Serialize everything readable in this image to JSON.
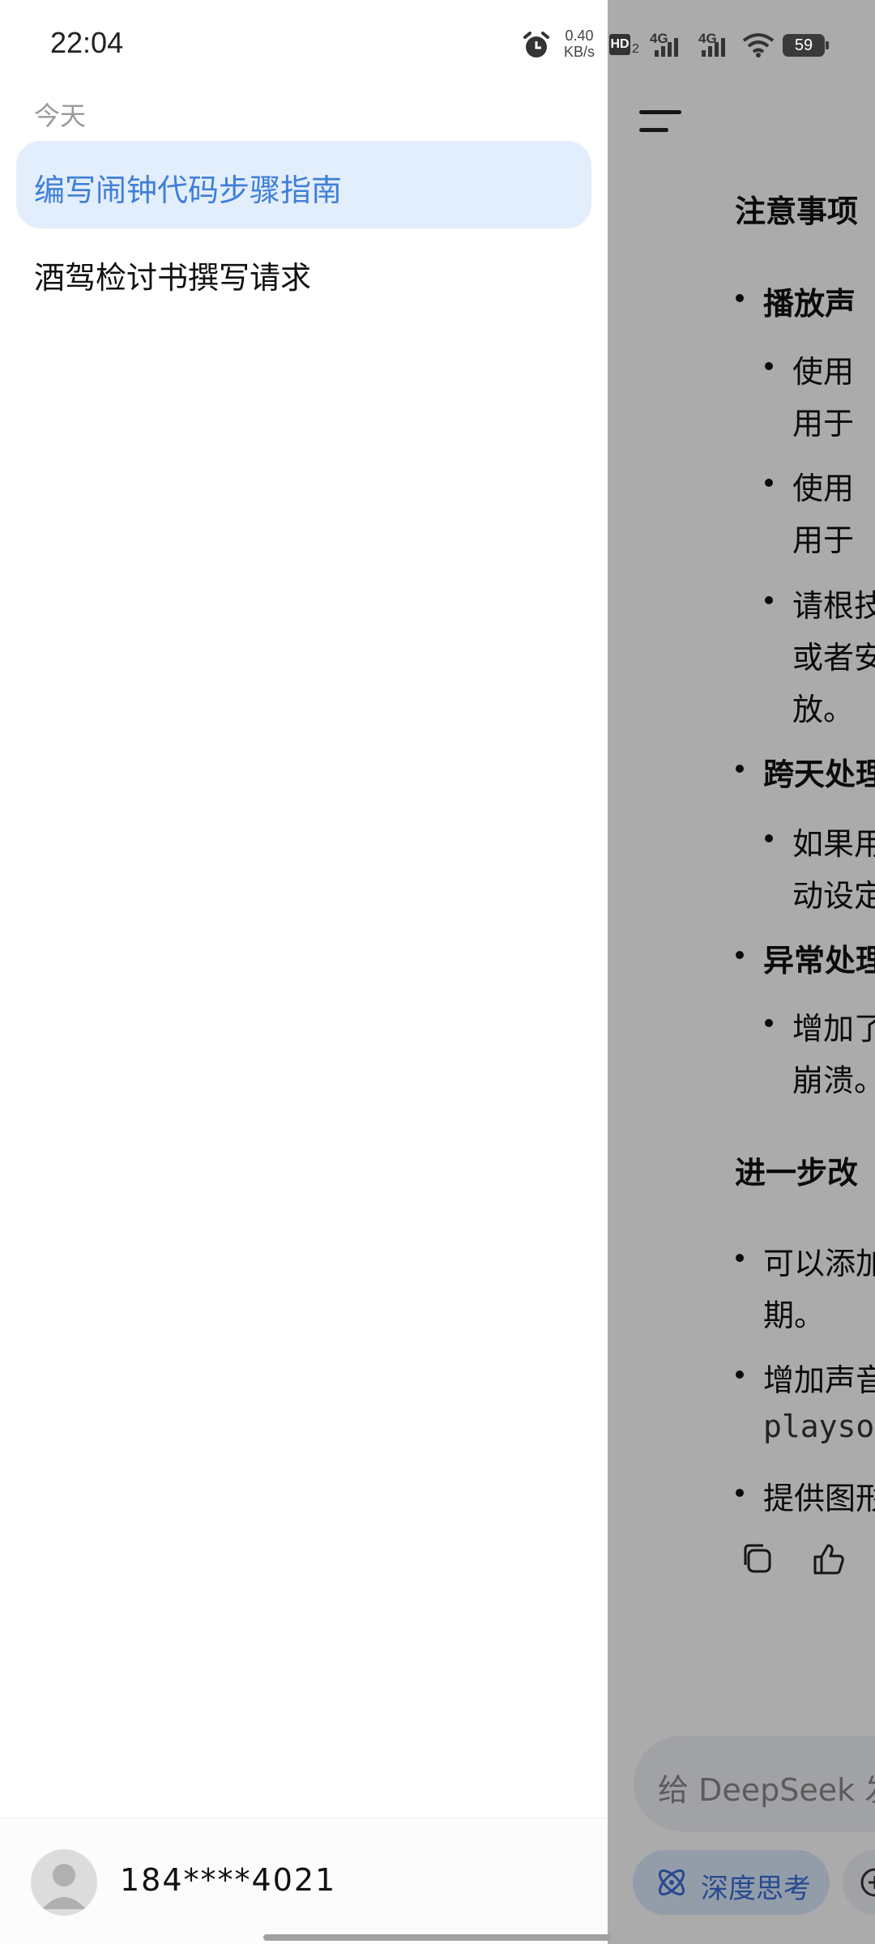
{
  "status_bar": {
    "time": "22:04",
    "net_speed_value": "0.40",
    "net_speed_unit": "KB/s",
    "hd_label": "HD",
    "hd_sub": "2",
    "sig1_label": "4G",
    "sig2_label": "4G",
    "battery": "59"
  },
  "drawer": {
    "section_label": "今天",
    "conversations": [
      {
        "title": "编写闹钟代码步骤指南",
        "active": true
      },
      {
        "title": "酒驾检讨书撰写请求",
        "active": false
      }
    ],
    "user": {
      "phone": "184****4021"
    }
  },
  "chat": {
    "heading_notes": "注意事项",
    "items": [
      {
        "text": "播放声",
        "bold": true,
        "level": 1
      },
      {
        "text": "使用",
        "bold": false,
        "level": 2
      },
      {
        "text": "用于",
        "bold": false,
        "level": 2,
        "continuation": true
      },
      {
        "text": "使用",
        "bold": false,
        "level": 2
      },
      {
        "text": "用于",
        "bold": false,
        "level": 2,
        "continuation": true
      },
      {
        "text": "请根技",
        "bold": false,
        "level": 2
      },
      {
        "text": "或者安",
        "bold": false,
        "level": 2,
        "continuation": true
      },
      {
        "text": "放。",
        "bold": false,
        "level": 2,
        "continuation": true
      },
      {
        "text": "跨天处理",
        "bold": true,
        "level": 1
      },
      {
        "text": "如果用",
        "bold": false,
        "level": 2
      },
      {
        "text": "动设定",
        "bold": false,
        "level": 2,
        "continuation": true
      },
      {
        "text": "异常处理",
        "bold": true,
        "level": 1
      },
      {
        "text": "增加了",
        "bold": false,
        "level": 2
      },
      {
        "text": "崩溃。",
        "bold": false,
        "level": 2,
        "continuation": true
      }
    ],
    "heading_improve": "进一步改",
    "improve_items": [
      {
        "text": "可以添加",
        "continuation": false
      },
      {
        "text": "期。",
        "continuation": true
      },
      {
        "text": "增加声音",
        "continuation": false
      },
      {
        "text": "playsound",
        "continuation": true,
        "code": true
      },
      {
        "text": "提供图形",
        "continuation": false
      }
    ],
    "composer_placeholder": "给 DeepSeek 发送消息",
    "deepthink_label": "深度思考"
  },
  "colors": {
    "accent": "#3f7fd8",
    "active_bg": "#e3eefc",
    "overlay": "rgba(0,0,0,0.33)"
  }
}
